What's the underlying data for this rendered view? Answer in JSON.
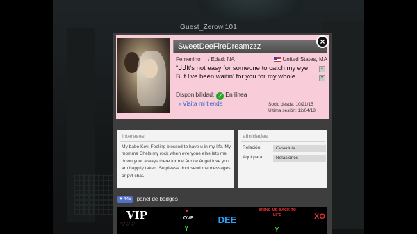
{
  "scene": {
    "guest_name": "Guest_Zerowi101"
  },
  "profile": {
    "close_label": "×",
    "username": "SweetDeeFireDreamzzz",
    "gender": "Femenino",
    "age": "/ Edad: NA",
    "location": "United States, MA",
    "motto_line1": "“ᒍᒍIt's not easy for someone to catch my eye",
    "motto_line2": "But I've been waitin' for you for my whole",
    "availability_label": "Disponibilidad:",
    "availability_state": "En línea",
    "shop_link": "Visita mi tienda",
    "member_since": "Socio desde:  10/21/15",
    "last_session": "Última sesión:  12/04/18"
  },
  "interests": {
    "title": "Intereses",
    "text": "My babe Key. Feeling blessed to have u in my life. My momma Chels my rock when everyone else lets me down your always there for me Auntie Angel love you I am happily taken. So please dont send me messages or pvt chat."
  },
  "affinities": {
    "title": "afinidades",
    "relation_label": "Relación:",
    "relation_value": "Casado/a",
    "here_for_label": "Aquí para:",
    "here_for_value": "Relaciones"
  },
  "badges": {
    "count": "445",
    "label": "panel de badges",
    "vip": "VIP",
    "love": "LOVE",
    "dee": "DEE",
    "back_to_life": "BRING ME BACK TO LIFE",
    "xo": "XO"
  },
  "colors": {
    "profile_bg": "#f8cdd9",
    "panel_bg": "#3e3e3e",
    "link": "#3a5fc8",
    "online": "#2aa52a"
  },
  "icons": {
    "close": "close-icon",
    "flag": "us-flag-icon",
    "online": "check-circle-icon",
    "shop": "shop-link-icon",
    "badges": "star-icon"
  }
}
